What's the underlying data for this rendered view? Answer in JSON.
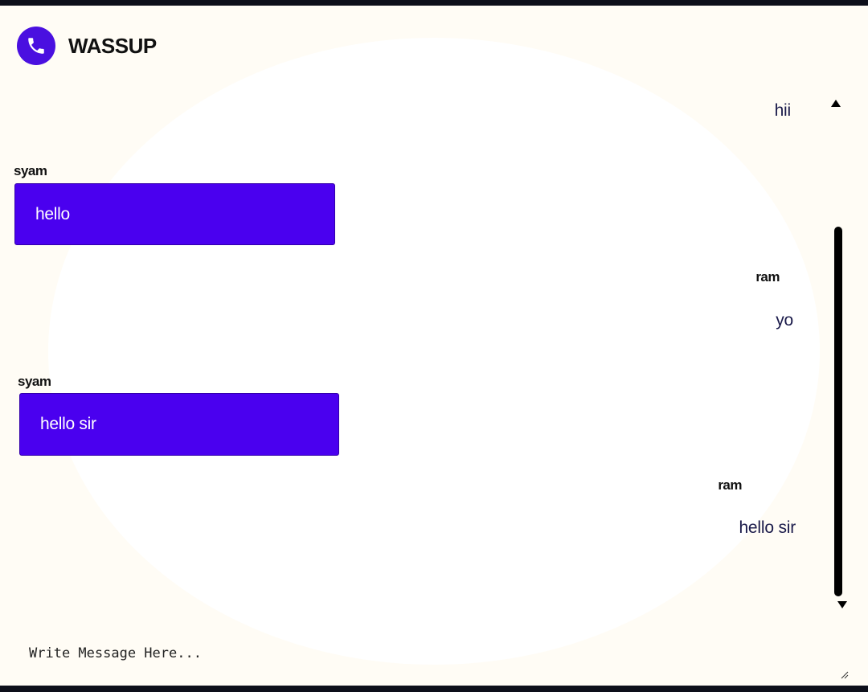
{
  "app": {
    "title": "WASSUP",
    "logo_icon": "phone-icon",
    "accent": "#4a00ef"
  },
  "messages": [
    {
      "side": "right",
      "sender": "",
      "text": "hii"
    },
    {
      "side": "left",
      "sender": "syam",
      "text": "hello"
    },
    {
      "side": "right",
      "sender": "ram",
      "text": "yo"
    },
    {
      "side": "left",
      "sender": "syam",
      "text": "hello sir"
    },
    {
      "side": "right",
      "sender": "ram",
      "text": "hello sir"
    }
  ],
  "composer": {
    "placeholder": "Write Message Here..."
  }
}
